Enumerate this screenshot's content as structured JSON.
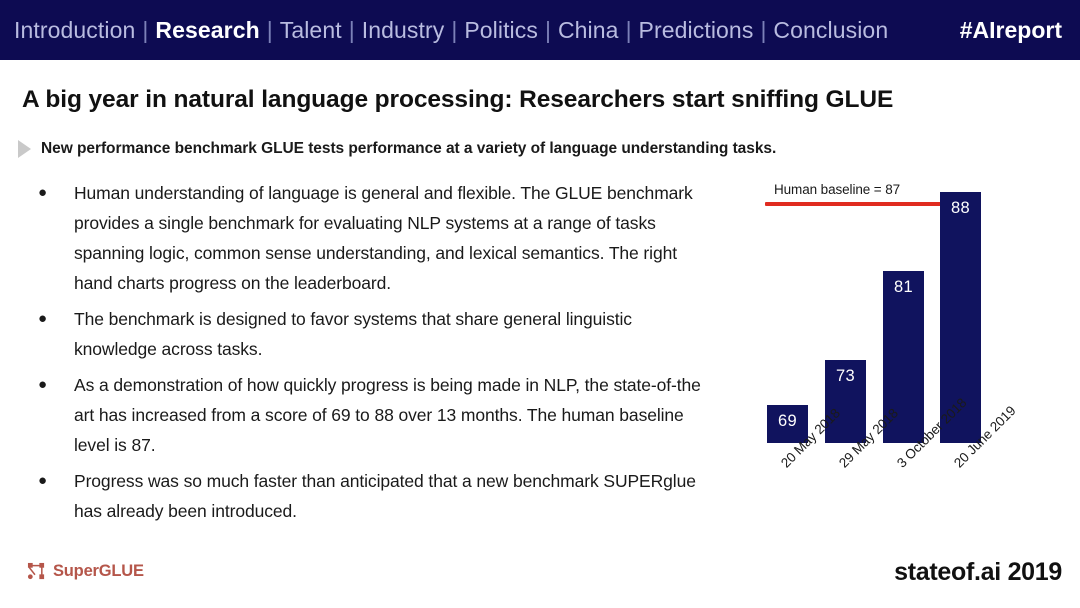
{
  "navbar": {
    "items": [
      {
        "label": "Introduction",
        "active": false
      },
      {
        "label": "Research",
        "active": true
      },
      {
        "label": "Talent",
        "active": false
      },
      {
        "label": "Industry",
        "active": false
      },
      {
        "label": "Politics",
        "active": false
      },
      {
        "label": "China",
        "active": false
      },
      {
        "label": "Predictions",
        "active": false
      },
      {
        "label": "Conclusion",
        "active": false
      }
    ],
    "separator": "|",
    "hashtag": "#AIreport",
    "background_color": "#0d0b52",
    "active_color": "#ffffff",
    "inactive_color": "#b9bce0"
  },
  "headline": "A big year in natural language processing: Researchers start sniffing GLUE",
  "subhead": "New performance benchmark GLUE tests performance at a variety of language understanding tasks.",
  "bullets": [
    {
      "marker": "●",
      "text": "Human understanding of language is general and flexible. The GLUE benchmark provides a single benchmark for evaluating NLP systems at a range of tasks spanning logic, common sense understanding, and lexical semantics. The right hand charts progress on the leaderboard."
    },
    {
      "marker": "●",
      "text": "The benchmark is designed to favor systems that share general linguistic knowledge across tasks."
    },
    {
      "marker": "●",
      "text": "As a demonstration of how quickly progress is being made in NLP, the state-of-the art has increased from a score of 69 to 88 over 13 months. The human baseline level is 87."
    },
    {
      "marker": "●",
      "text": "Progress was so much faster than anticipated that a new benchmark SUPERglue has already been introduced."
    }
  ],
  "chart_data": {
    "type": "bar",
    "title": "",
    "xlabel": "",
    "ylabel": "",
    "categories": [
      "20 May 2018",
      "29 May 2018",
      "3 October 2018",
      "20 June 2019"
    ],
    "values": [
      69,
      73,
      81,
      88
    ],
    "value_labels": [
      "69",
      "73",
      "81",
      "88"
    ],
    "ylim": [
      65.6,
      90
    ],
    "grid": false,
    "legend": false,
    "bar_color": "#10135e",
    "value_label_color": "#ffffff",
    "annotations": [
      {
        "name": "human-baseline",
        "label": "Human baseline = 87",
        "value": 87,
        "color": "#e02b20",
        "style": "horizontal-line"
      }
    ]
  },
  "footer": {
    "logo_text": "SuperGLUE",
    "logo_color": "#b5564a",
    "logo_icon": "node-graph-icon",
    "brand": "stateof.ai 2019"
  }
}
